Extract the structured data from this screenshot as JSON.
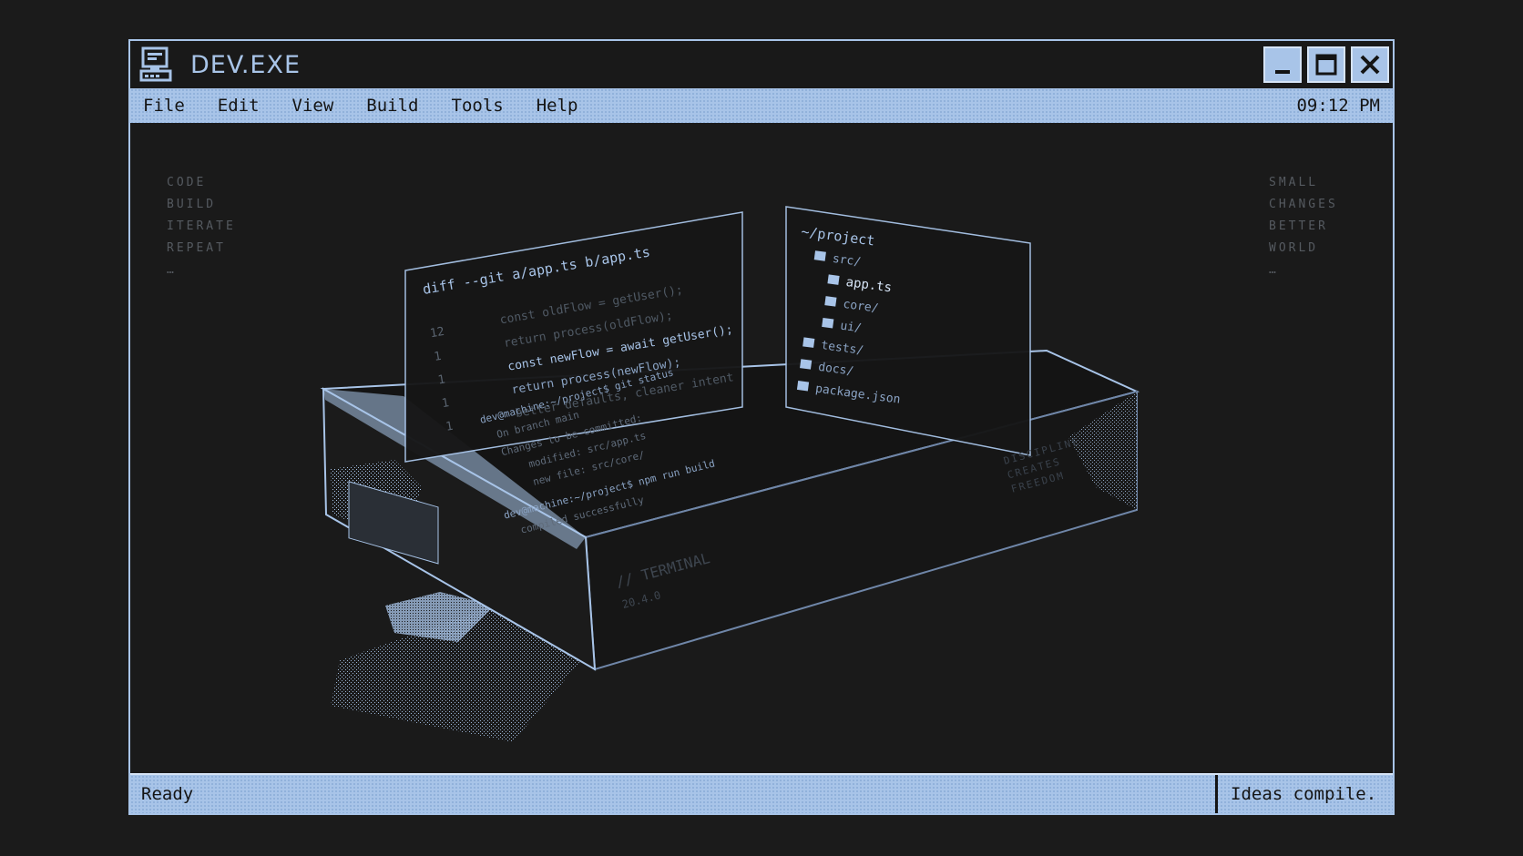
{
  "window": {
    "title": "DEV.EXE",
    "icon": "computer-icon",
    "buttons": [
      {
        "name": "minimize",
        "icon": "minimize-icon"
      },
      {
        "name": "maximize",
        "icon": "maximize-icon"
      },
      {
        "name": "close",
        "icon": "close-icon"
      }
    ]
  },
  "menu": {
    "items": [
      "File",
      "Edit",
      "View",
      "Build",
      "Tools",
      "Help"
    ],
    "clock": "09:12 PM"
  },
  "left_notes": [
    "CODE",
    "BUILD",
    "ITERATE",
    "REPEAT",
    "…"
  ],
  "right_notes": [
    "SMALL",
    "CHANGES",
    "BETTER",
    "WORLD",
    "…"
  ],
  "diff_panel": {
    "header": "diff --git a/app.ts b/app.ts",
    "line_numbers": [
      "12",
      "1",
      "1",
      "1",
      "1"
    ],
    "lines": [
      "const oldFlow = getUser();",
      "return process(oldFlow);",
      "const newFlow = await getUser();",
      "return process(newFlow);",
      "better defaults, cleaner intent"
    ]
  },
  "tree_panel": {
    "root": "~/project",
    "items": [
      "src/",
      "app.ts",
      "core/",
      "ui/",
      "tests/",
      "docs/",
      "package.json"
    ]
  },
  "device": {
    "screen_lines": [
      "dev@machine:~/project$ git status",
      "On branch main",
      "Changes to be committed:",
      "modified:  src/app.ts",
      "new file:  src/core/",
      "dev@machine:~/project$ npm run build",
      "compiled successfully"
    ],
    "front_label": "// TERMINAL",
    "front_version": "20.4.0",
    "side_text": [
      "DISCIPLINE",
      "CREATES",
      "FREEDOM"
    ]
  },
  "status": {
    "left": "Ready",
    "right": "Ideas compile."
  },
  "colors": {
    "accent": "#a8c4e8",
    "background": "#1b1b1b",
    "text_dark": "#141414"
  }
}
